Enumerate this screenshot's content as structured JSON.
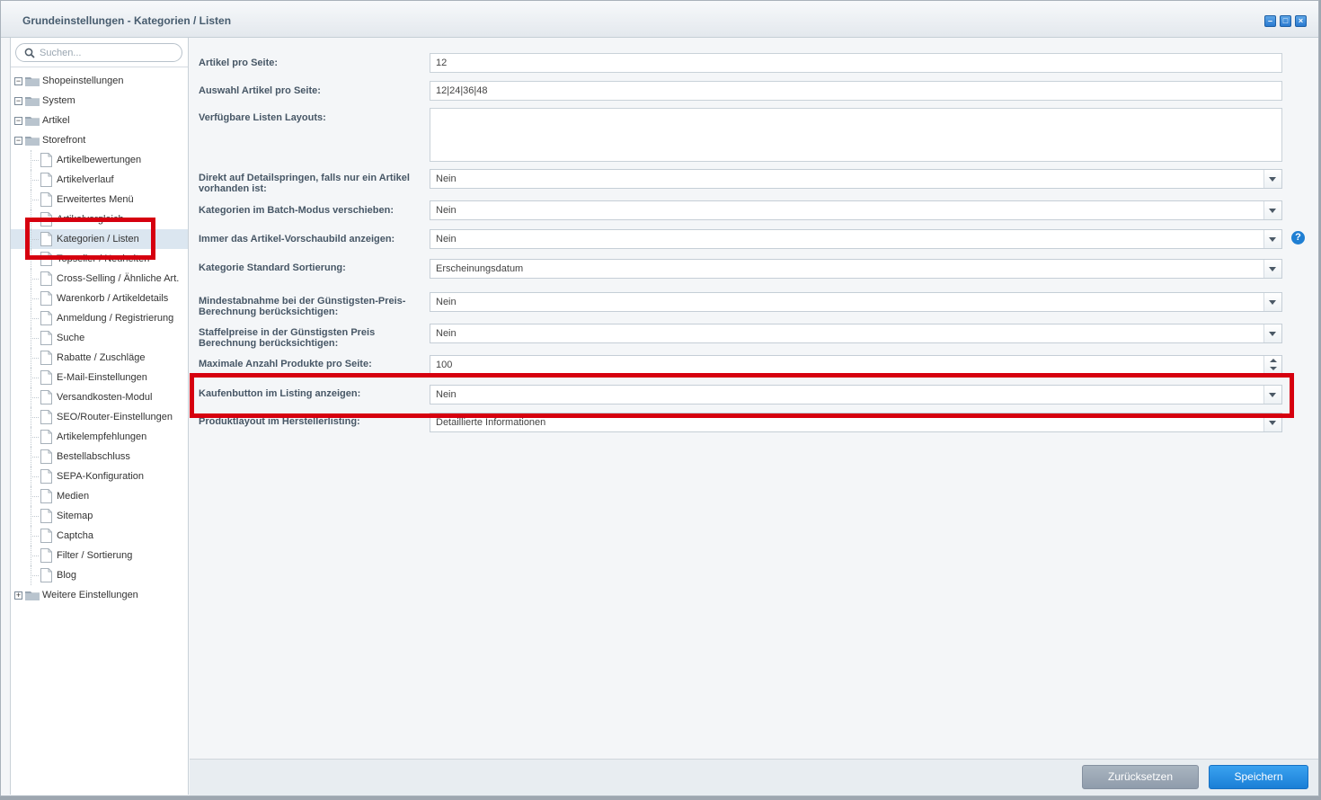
{
  "window": {
    "title": "Grundeinstellungen - Kategorien / Listen"
  },
  "search": {
    "placeholder": "Suchen..."
  },
  "tree": {
    "folders": {
      "shop": "Shopeinstellungen",
      "system": "System",
      "artikel": "Artikel",
      "storefront": "Storefront",
      "weitere": "Weitere Einstellungen"
    },
    "storefront_items": [
      "Artikelbewertungen",
      "Artikelverlauf",
      "Erweitertes Menü",
      "Artikelvergleich",
      "Kategorien / Listen",
      "Topseller / Neuheiten",
      "Cross-Selling / Ähnliche Art.",
      "Warenkorb / Artikeldetails",
      "Anmeldung / Registrierung",
      "Suche",
      "Rabatte / Zuschläge",
      "E-Mail-Einstellungen",
      "Versandkosten-Modul",
      "SEO/Router-Einstellungen",
      "Artikelempfehlungen",
      "Bestellabschluss",
      "SEPA-Konfiguration",
      "Medien",
      "Sitemap",
      "Captcha",
      "Filter / Sortierung",
      "Blog"
    ]
  },
  "form": {
    "artikel_pro_seite": {
      "label": "Artikel pro Seite:",
      "value": "12"
    },
    "auswahl_artikel": {
      "label": "Auswahl Artikel pro Seite:",
      "value": "12|24|36|48"
    },
    "listen_layouts": {
      "label": "Verfügbare Listen Layouts:",
      "value": ""
    },
    "direkt_detail": {
      "label": "Direkt auf Detailspringen, falls nur ein Artikel vorhanden ist:",
      "value": "Nein"
    },
    "batch_modus": {
      "label": "Kategorien im Batch-Modus verschieben:",
      "value": "Nein"
    },
    "vorschaubild": {
      "label": "Immer das Artikel-Vorschaubild anzeigen:",
      "value": "Nein",
      "help": "?"
    },
    "standard_sortierung": {
      "label": "Kategorie Standard Sortierung:",
      "value": "Erscheinungsdatum"
    },
    "mindestabnahme": {
      "label": "Mindestabnahme bei der Günstigsten-Preis-Berechnung berücksichtigen:",
      "value": "Nein"
    },
    "staffelpreise": {
      "label": "Staffelpreise in der Günstigsten Preis Berechnung berücksichtigen:",
      "value": "Nein"
    },
    "max_produkte": {
      "label": "Maximale Anzahl Produkte pro Seite:",
      "value": "100"
    },
    "kaufenbutton": {
      "label": "Kaufenbutton im Listing anzeigen:",
      "value": "Nein"
    },
    "produktlayout": {
      "label": "Produktlayout im Herstellerlisting:",
      "value": "Detaillierte Informationen"
    }
  },
  "footer": {
    "reset": "Zurücksetzen",
    "save": "Speichern"
  },
  "colors": {
    "highlight": "#d6000f",
    "primary": "#1a7fd6"
  }
}
